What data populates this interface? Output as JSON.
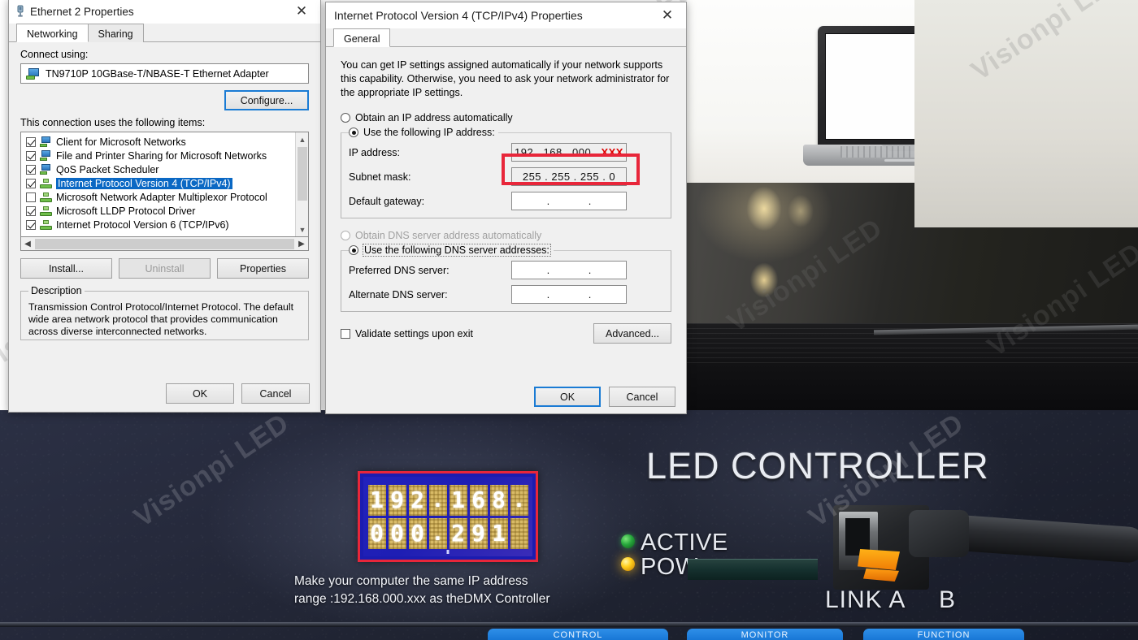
{
  "watermark": {
    "text": "Visionpi LED"
  },
  "ethernet_dialog": {
    "title": "Ethernet 2 Properties",
    "icon": "network-adapter-icon",
    "close_label": "✕",
    "tabs": [
      {
        "label": "Networking",
        "active": true
      },
      {
        "label": "Sharing",
        "active": false
      }
    ],
    "connect_using_label": "Connect using:",
    "adapter_name": "TN9710P 10GBase-T/NBASE-T Ethernet Adapter",
    "configure_button": "Configure...",
    "items_label": "This connection uses the following items:",
    "items": [
      {
        "label": "Client for Microsoft Networks",
        "checked": true,
        "selected": false,
        "icon": "network-client-icon"
      },
      {
        "label": "File and Printer Sharing for Microsoft Networks",
        "checked": true,
        "selected": false,
        "icon": "network-client-icon"
      },
      {
        "label": "QoS Packet Scheduler",
        "checked": true,
        "selected": false,
        "icon": "network-client-icon"
      },
      {
        "label": "Internet Protocol Version 4 (TCP/IPv4)",
        "checked": true,
        "selected": true,
        "icon": "protocol-icon"
      },
      {
        "label": "Microsoft Network Adapter Multiplexor Protocol",
        "checked": false,
        "selected": false,
        "icon": "protocol-icon"
      },
      {
        "label": "Microsoft LLDP Protocol Driver",
        "checked": true,
        "selected": false,
        "icon": "protocol-icon"
      },
      {
        "label": "Internet Protocol Version 6 (TCP/IPv6)",
        "checked": true,
        "selected": false,
        "icon": "protocol-icon"
      }
    ],
    "install_button": "Install...",
    "uninstall_button": "Uninstall",
    "properties_button": "Properties",
    "description_legend": "Description",
    "description_text": "Transmission Control Protocol/Internet Protocol. The default wide area network protocol that provides communication across diverse interconnected networks.",
    "ok_button": "OK",
    "cancel_button": "Cancel"
  },
  "tcpip_dialog": {
    "title": "Internet Protocol Version 4 (TCP/IPv4) Properties",
    "close_label": "✕",
    "tabs": [
      {
        "label": "General",
        "active": true
      }
    ],
    "intro_text": "You can get IP settings assigned automatically if your network supports this capability. Otherwise, you need to ask your network administrator for the appropriate IP settings.",
    "radio_auto_ip": "Obtain an IP address automatically",
    "radio_manual_ip": "Use the following IP address:",
    "ip_address_label": "IP address:",
    "ip_address_value": "192 . 168 . 000 .",
    "ip_address_value_highlight": "XXX",
    "subnet_label": "Subnet mask:",
    "subnet_value": "255 . 255 . 255 .  0",
    "gateway_label": "Default gateway:",
    "gateway_value": ".     .",
    "radio_auto_dns": "Obtain DNS server address automatically",
    "radio_manual_dns": "Use the following DNS server addresses:",
    "preferred_dns_label": "Preferred DNS server:",
    "preferred_dns_value": ".     .",
    "alternate_dns_label": "Alternate DNS server:",
    "alternate_dns_value": ".     .",
    "validate_checkbox_label": "Validate settings upon exit",
    "validate_checked": false,
    "advanced_button": "Advanced...",
    "ok_button": "OK",
    "cancel_button": "Cancel",
    "highlight_color": "#e8263a"
  },
  "photo": {
    "product_title": "LED CONTROLLER",
    "display": {
      "row1": [
        "1",
        "9",
        "2",
        ".",
        "1",
        "6",
        "8",
        "."
      ],
      "row2": [
        "0",
        "0",
        "0",
        ".",
        "2",
        "9",
        "1",
        " "
      ],
      "border_color": "#e8263a",
      "screen_color": "#1b1cb0"
    },
    "caption_line1": "Make your computer the same IP address",
    "caption_line2": "range :192.168.000.xxx as theDMX  Controller",
    "indicators": [
      {
        "label": "ACTIVE",
        "color": "#2fa83c",
        "name": "active-led"
      },
      {
        "label": "POW",
        "color": "#ffcf1d",
        "name": "power-led"
      }
    ],
    "port_labels": {
      "link": "LINK A",
      "b": "B"
    },
    "bottom_buttons": [
      "CONTROL",
      "MONITOR",
      "FUNCTION"
    ]
  }
}
